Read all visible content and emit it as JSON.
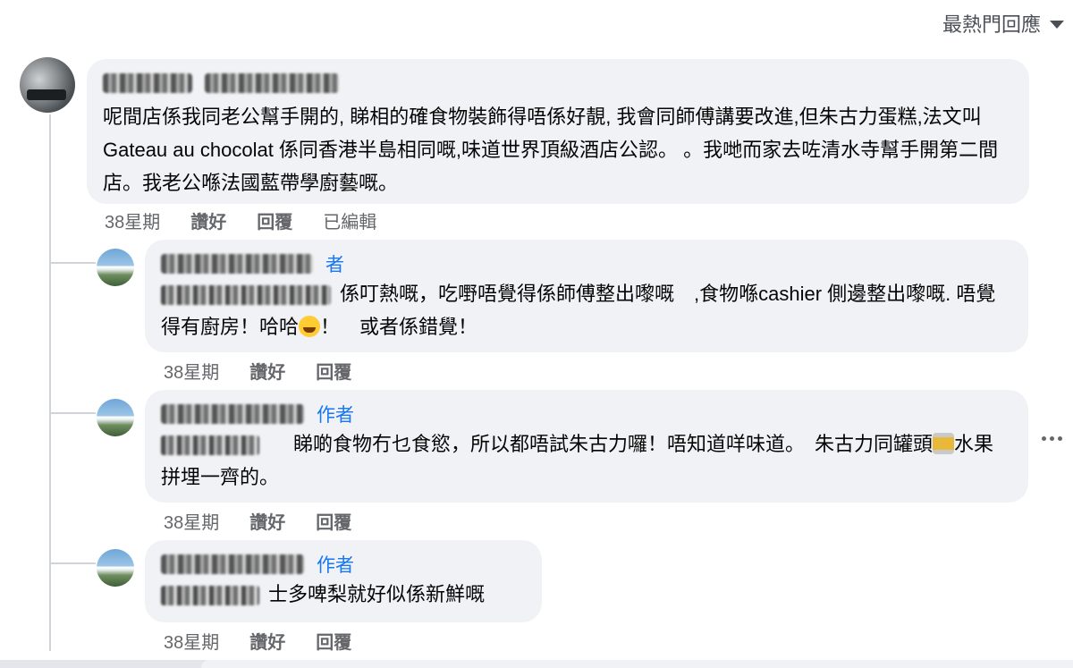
{
  "sort": {
    "label": "最熱門回應",
    "icon": "caret-down-icon"
  },
  "main_comment": {
    "text": "呢間店係我同老公幫手開的, 睇相的確食物裝飾得唔係好靚, 我會同師傅講要改進,但朱古力蛋糕,法文叫Gateau au chocolat 係同香港半島相同嘅,味道世界頂級酒店公認。 。我哋而家去咗清水寺幫手開第二間店。我老公喺法國藍帶學廚藝嘅。",
    "time": "38星期",
    "like": "讚好",
    "reply": "回覆",
    "edited": "已編輯"
  },
  "replies": [
    {
      "author_badge": "者",
      "text_a": "係叮熱嘅，吃嘢唔覺得係師傅整出嚟嘅　,食物喺cashier 側邊整出嚟嘅. 唔覺得有廚房！哈哈",
      "text_b": "！　或者係錯覺！",
      "emoji": "smile-emoji-icon",
      "time": "38星期",
      "like": "讚好",
      "reply": "回覆"
    },
    {
      "author_badge": "作者",
      "text_a": "睇啲食物冇乜食慾，所以都唔試朱古力囉！唔知道咩味道。　朱古力同罐頭",
      "text_b": "水果拼埋一齊的。",
      "emoji": "canned-food-icon",
      "time": "38星期",
      "like": "讚好",
      "reply": "回覆"
    },
    {
      "author_badge": "作者",
      "text_a": "士多啤梨就好似係新鮮嘅",
      "time": "38星期",
      "like": "讚好",
      "reply": "回覆"
    }
  ],
  "colors": {
    "bubble": "#f0f2f5",
    "author": "#1877f2",
    "meta": "#65676b"
  }
}
